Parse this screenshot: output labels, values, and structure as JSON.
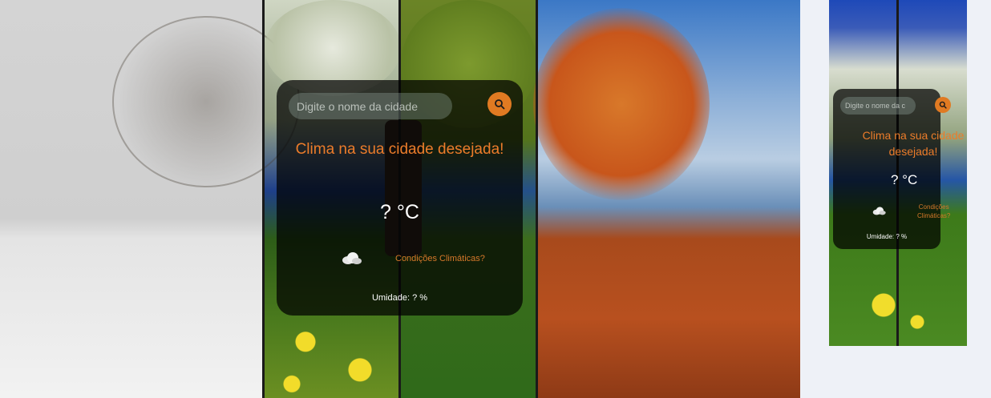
{
  "desktop": {
    "search": {
      "placeholder": "Digite o nome da cidade"
    },
    "search_button_icon": "search-icon",
    "title": "Clima na sua cidade desejada!",
    "temperature": "? °C",
    "weather_icon": "cloud-icon",
    "condition": "Condições Climáticas?",
    "humidity": "Umidade: ? %"
  },
  "mobile": {
    "search": {
      "placeholder": "Digite o nome da c"
    },
    "search_button_icon": "search-icon",
    "title": "Clima na sua cidade desejada!",
    "temperature": "? °C",
    "weather_icon": "cloud-icon",
    "condition_line1": "Condições",
    "condition_line2": "Climáticas?",
    "humidity": "Umidade: ? %"
  },
  "colors": {
    "accent": "#e07a22",
    "title_text": "#ec7c2a",
    "card_bg": "rgba(0,0,0,0.72)",
    "page_bg": "#eef1f7"
  }
}
